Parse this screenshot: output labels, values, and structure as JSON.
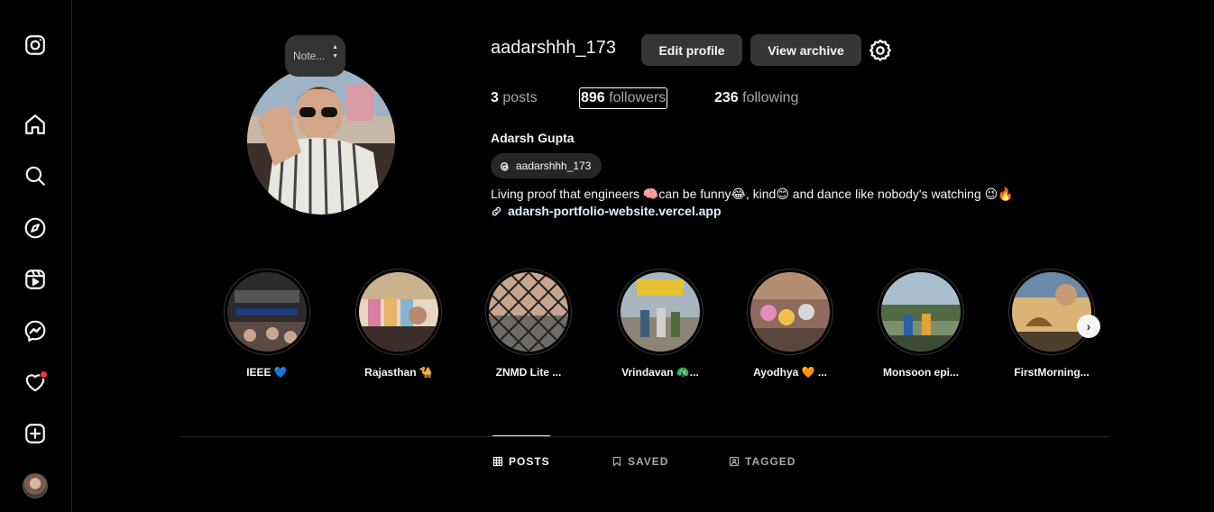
{
  "sidebar": {
    "items": [
      {
        "icon": "instagram-logo-icon"
      },
      {
        "icon": "home-icon"
      },
      {
        "icon": "search-icon"
      },
      {
        "icon": "explore-icon"
      },
      {
        "icon": "reels-icon"
      },
      {
        "icon": "messenger-icon"
      },
      {
        "icon": "heart-icon"
      },
      {
        "icon": "create-icon"
      },
      {
        "icon": "profile-avatar"
      }
    ],
    "notification_color": "#ff3040"
  },
  "profile": {
    "note": "Note...",
    "username": "aadarshhh_173",
    "edit_label": "Edit profile",
    "archive_label": "View archive",
    "posts_count": "3",
    "posts_label": "posts",
    "followers_count": "896",
    "followers_label": "followers",
    "following_count": "236",
    "following_label": "following",
    "full_name": "Adarsh Gupta",
    "threads_handle": "aadarshhh_173",
    "bio": "Living proof that engineers 🧠can be funny😂, kind😊 and dance like nobody's watching 😉🔥",
    "link": "adarsh-portfolio-website.vercel.app"
  },
  "highlights": [
    {
      "label": "IEEE 💙"
    },
    {
      "label": "Rajasthan 🐪"
    },
    {
      "label": "ZNMD Lite ..."
    },
    {
      "label": "Vrindavan 🦚..."
    },
    {
      "label": "Ayodhya 🧡 ..."
    },
    {
      "label": "Monsoon epi..."
    },
    {
      "label": "FirstMorning..."
    }
  ],
  "tabs": [
    {
      "label": "POSTS",
      "active": true
    },
    {
      "label": "SAVED",
      "active": false
    },
    {
      "label": "TAGGED",
      "active": false
    }
  ]
}
